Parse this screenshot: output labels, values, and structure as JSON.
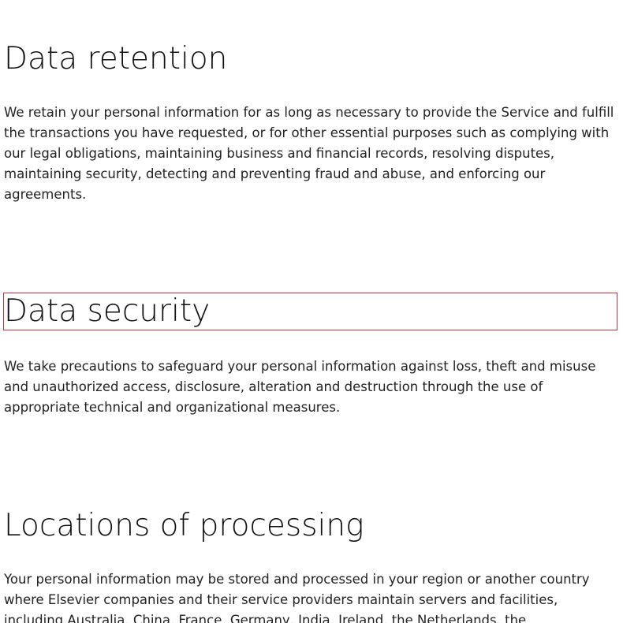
{
  "sections": [
    {
      "heading": "Data retention",
      "body": "We retain your personal information for as long as necessary to provide the Service and fulfill the transactions you have requested, or for other essential purposes such as complying with our legal obligations, maintaining business and financial records, resolving disputes, maintaining security, detecting and preventing fraud and abuse, and enforcing our agreements."
    },
    {
      "heading": "Data security",
      "body": "We take precautions to safeguard your personal information against loss, theft and misuse and unauthorized access, disclosure, alteration and destruction through the use of appropriate technical and organizational measures."
    },
    {
      "heading": "Locations of processing",
      "body": "Your personal information may be stored and processed in your region or another country where Elsevier companies and their service providers maintain servers and facilities, including Australia, China, France, Germany, India, Ireland, the Netherlands, the"
    }
  ],
  "colors": {
    "focus_outline": "#c8323c",
    "text": "#222222",
    "background": "#ffffff"
  }
}
